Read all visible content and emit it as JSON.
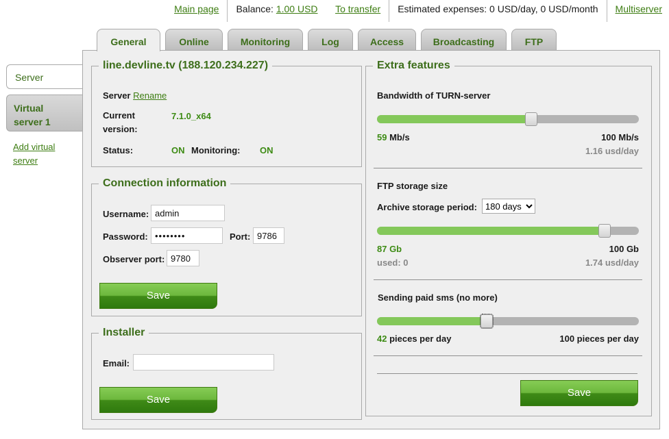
{
  "topbar": {
    "main_page": "Main page",
    "balance_label": "Balance:",
    "balance_value": "1.00 USD",
    "to_transfer": "To transfer",
    "estimated": "Estimated expenses: 0 USD/day, 0 USD/month",
    "multiserver": "Multiserver"
  },
  "tabs": [
    "General",
    "Online",
    "Monitoring",
    "Log",
    "Access",
    "Broadcasting",
    "FTP"
  ],
  "sidebar": {
    "server": "Server",
    "virtual_line1": "Virtual",
    "virtual_line2": "server 1",
    "add_line1": "Add virtual",
    "add_line2": "server"
  },
  "server_box": {
    "legend": "line.devline.tv (188.120.234.227)",
    "server_label": "Server",
    "rename": "Rename",
    "current_line1": "Current",
    "current_line2": "version:",
    "version": "7.1.0_x64",
    "status_label": "Status:",
    "status_value": "ON",
    "monitoring_label": "Monitoring:",
    "monitoring_value": "ON"
  },
  "connection": {
    "legend": "Connection information",
    "username_label": "Username:",
    "username_value": "admin",
    "password_label": "Password:",
    "password_value": "••••••••",
    "port_label": "Port:",
    "port_value": "9786",
    "observer_label": "Observer port:",
    "observer_value": "9780",
    "save": "Save"
  },
  "installer": {
    "legend": "Installer",
    "email_label": "Email:",
    "email_value": "",
    "save": "Save"
  },
  "extra": {
    "legend": "Extra features",
    "turn": {
      "title": "Bandwidth of TURN-server",
      "value": "59",
      "unit": "Mb/s",
      "max": "100 Mb/s",
      "price": "1.16 usd/day",
      "fraction": 0.59
    },
    "ftp": {
      "title": "FTP storage size",
      "period_label": "Archive storage period:",
      "period_value": "180 days",
      "value": "87 Gb",
      "max": "100 Gb",
      "used": "used: 0",
      "price": "1.74 usd/day",
      "fraction": 0.87
    },
    "sms": {
      "title": "Sending paid sms (no more)",
      "value": "42",
      "unit": "pieces per day",
      "max": "100 pieces per day",
      "fraction": 0.42
    },
    "save": "Save"
  },
  "colors": {
    "accent_green": "#3d6e1b",
    "value_green": "#3d8b14",
    "slider_fill": "#84c85a"
  }
}
